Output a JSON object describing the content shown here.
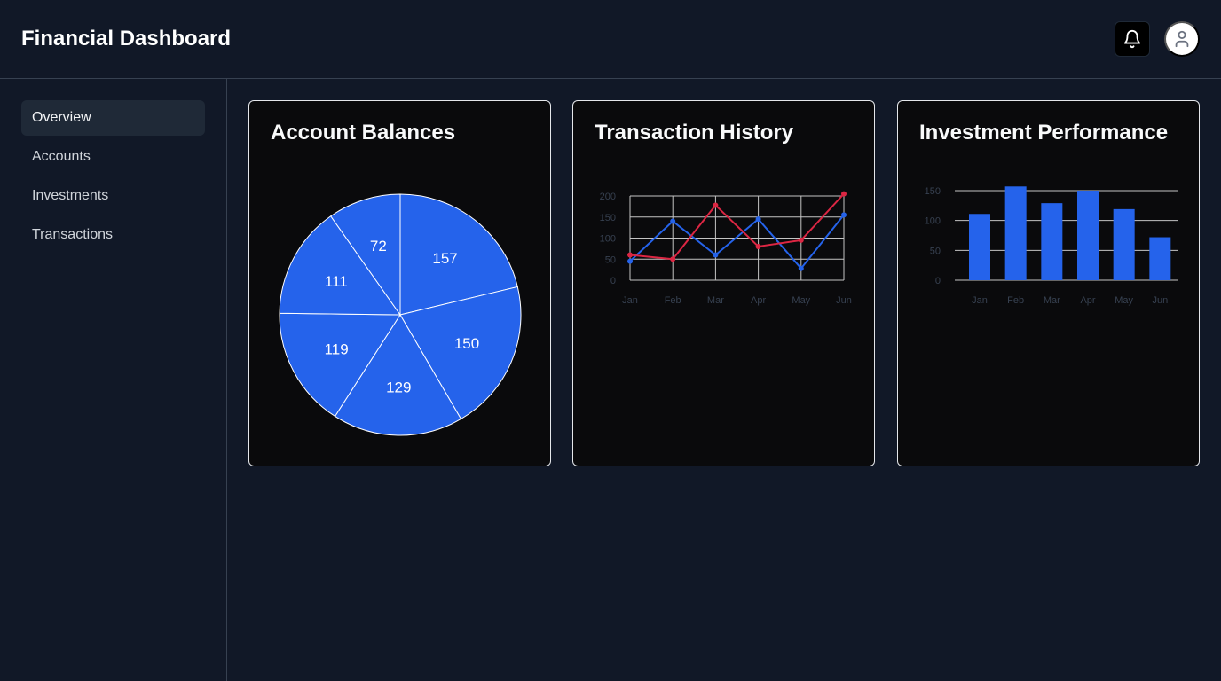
{
  "header": {
    "title": "Financial Dashboard",
    "notification_icon": "bell-icon",
    "profile_icon": "user-icon"
  },
  "sidebar": {
    "items": [
      {
        "label": "Overview",
        "active": true
      },
      {
        "label": "Accounts",
        "active": false
      },
      {
        "label": "Investments",
        "active": false
      },
      {
        "label": "Transactions",
        "active": false
      }
    ]
  },
  "colors": {
    "background": "#111827",
    "card_background": "#0a0a0c",
    "accent_blue": "#2563eb",
    "accent_red": "#dc2643",
    "grid": "#c4c4c4",
    "tick_text": "#374151"
  },
  "cards": {
    "balances": {
      "title": "Account Balances"
    },
    "transactions": {
      "title": "Transaction History"
    },
    "investments": {
      "title": "Investment Performance"
    }
  },
  "chart_data": [
    {
      "type": "pie",
      "title": "Account Balances",
      "values": [
        157,
        150,
        129,
        119,
        111,
        72
      ],
      "labels": [
        "157",
        "150",
        "129",
        "119",
        "111",
        "72"
      ],
      "color": "#2563eb"
    },
    {
      "type": "line",
      "title": "Transaction History",
      "categories": [
        "Jan",
        "Feb",
        "Mar",
        "Apr",
        "May",
        "Jun"
      ],
      "y_ticks": [
        0,
        50,
        100,
        150,
        200
      ],
      "ylim": [
        0,
        200
      ],
      "grid": true,
      "series": [
        {
          "color": "#2563eb",
          "values": [
            45,
            140,
            60,
            145,
            28,
            155
          ]
        },
        {
          "color": "#dc2643",
          "values": [
            60,
            50,
            178,
            80,
            95,
            205
          ]
        }
      ]
    },
    {
      "type": "bar",
      "title": "Investment Performance",
      "categories": [
        "Jan",
        "Feb",
        "Mar",
        "Apr",
        "May",
        "Jun"
      ],
      "values": [
        111,
        157,
        129,
        150,
        119,
        72
      ],
      "y_ticks": [
        0,
        50,
        100,
        150
      ],
      "ylim": [
        0,
        150
      ],
      "grid": true,
      "color": "#2563eb"
    }
  ]
}
